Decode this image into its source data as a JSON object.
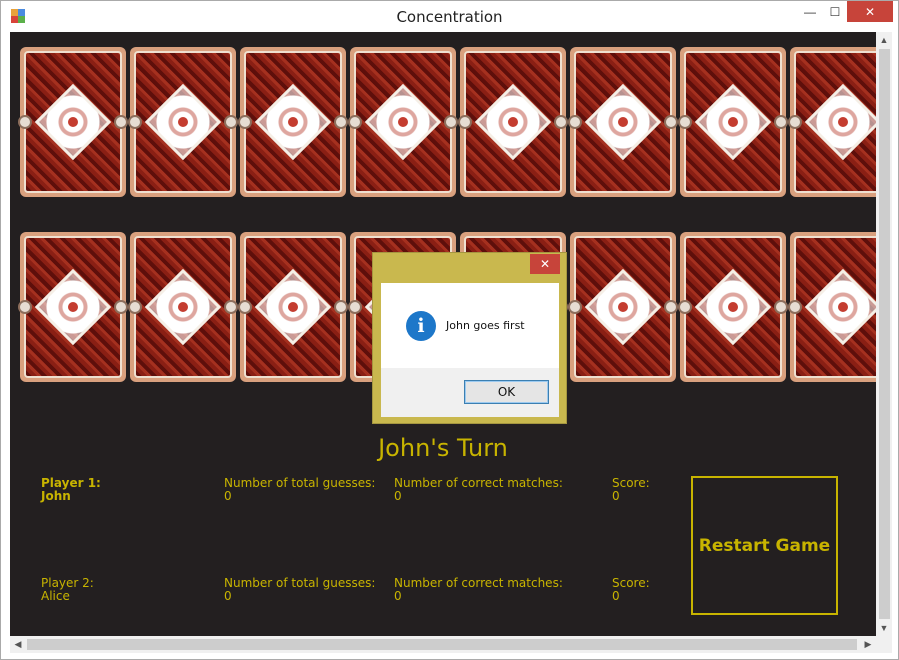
{
  "window": {
    "title": "Concentration",
    "controls": {
      "minimize": "—",
      "maximize": "☐",
      "close": "✕"
    }
  },
  "board": {
    "row1_count": 8,
    "row2_count": 8,
    "card_face": "card-back"
  },
  "turn_label": "John's Turn",
  "players": [
    {
      "label": "Player 1:",
      "name": "John",
      "guesses_label": "Number of total guesses:",
      "guesses": "0",
      "matches_label": "Number of correct matches:",
      "matches": "0",
      "score_label": "Score:",
      "score": "0"
    },
    {
      "label": "Player 2:",
      "name": "Alice",
      "guesses_label": "Number of total guesses:",
      "guesses": "0",
      "matches_label": "Number of correct matches:",
      "matches": "0",
      "score_label": "Score:",
      "score": "0"
    }
  ],
  "restart_label": "Restart Game",
  "dialog": {
    "close": "✕",
    "icon": "info-icon",
    "icon_glyph": "i",
    "message": "John goes first",
    "ok_label": "OK"
  },
  "colors": {
    "background": "#231f20",
    "accent": "#c8b400",
    "dialog_frame": "#c9b84e",
    "close_red": "#c7443a"
  }
}
